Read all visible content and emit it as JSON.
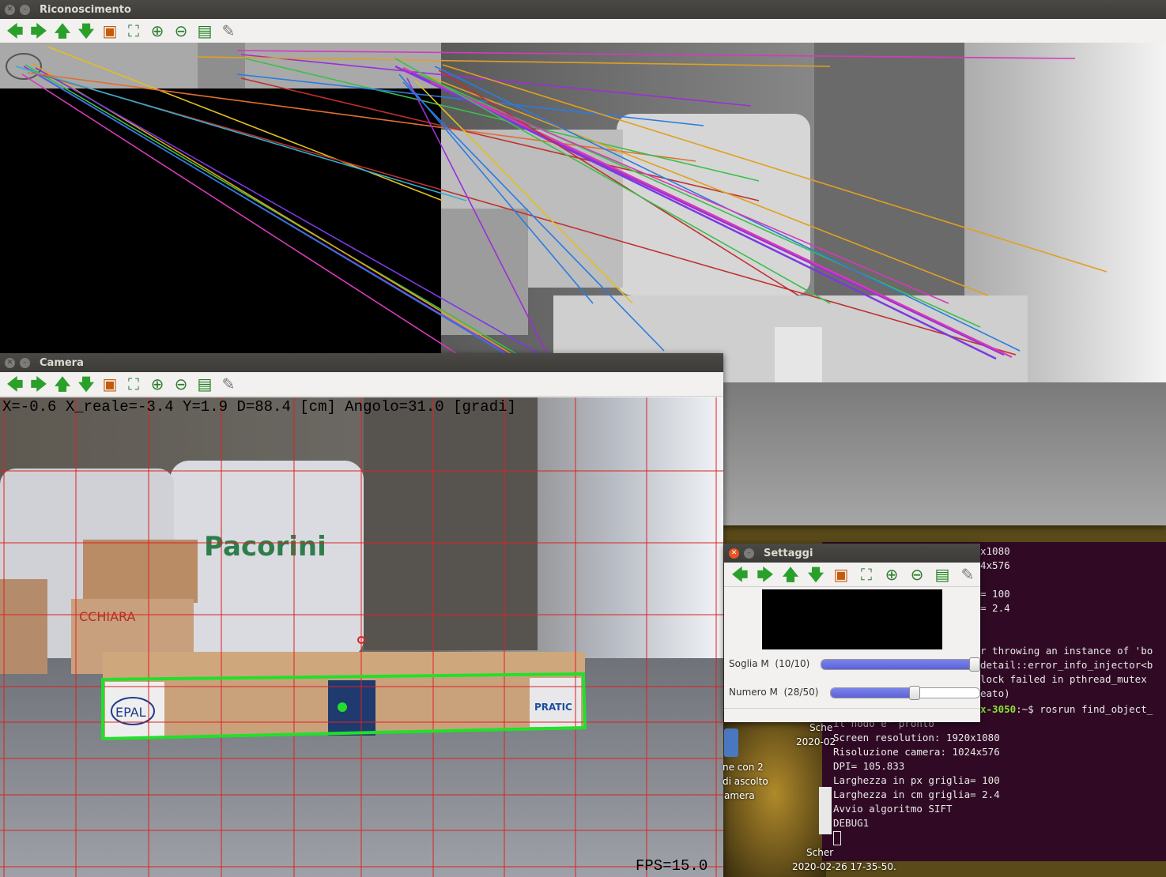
{
  "windows": {
    "main": {
      "title": "Riconoscimento"
    },
    "camera": {
      "title": "Camera"
    },
    "settings": {
      "title": "Settaggi"
    }
  },
  "toolbar": {
    "icons": [
      "arrow-left-icon",
      "arrow-right-icon",
      "arrow-up-icon",
      "arrow-down-icon",
      "image-icon",
      "fit-window-icon",
      "zoom-in-icon",
      "zoom-out-icon",
      "save-icon",
      "brush-icon"
    ]
  },
  "camera": {
    "overlay": "X=-0.6 X_reale=-3.4 Y=1.9 D=88.4 [cm] Angolo=31.0 [gradi]",
    "fps": "FPS=15.0",
    "scene_text": {
      "brand": "Pacorini",
      "epal": "EPAL",
      "box": "CCHIARA",
      "pallet_tag": "PRATIC"
    }
  },
  "settings": {
    "sliders": [
      {
        "label": "Soglia M",
        "value_text": "(10/10)",
        "value": 10,
        "max": 10
      },
      {
        "label": "Numero M",
        "value_text": "(28/50)",
        "value": 28,
        "max": 50
      }
    ]
  },
  "terminal": {
    "partial_top": [
      "x1080",
      "4x576",
      "= 100",
      "= 2.4"
    ],
    "partial_right": [
      "r throwing an instance of 'bo",
      "detail::error_info_injector<b",
      " lock failed in pthread_mutex",
      "eato)"
    ],
    "prompt_host": "x-3050",
    "prompt_rest": ":~$ rosrun find_object_",
    "lines": [
      "il nodo e' pronto",
      "Screen resolution: 1920x1080",
      "Risoluzione camera: 1024x576",
      "DPI= 105.833",
      "Larghezza in px griglia= 100",
      "Larghezza in cm griglia= 2.4",
      "Avvio algoritmo SIFT",
      "DEBUG1"
    ]
  },
  "desktop": {
    "labels": [
      "Sche",
      "2020-02",
      "ne con 2",
      "di ascolto",
      "amera",
      "Scher",
      "2020-02-26 17-35-50."
    ]
  }
}
